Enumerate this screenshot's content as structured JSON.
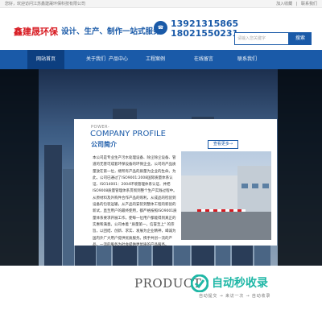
{
  "topbar": {
    "welcome": "您好，欢迎访问江苏鑫建晟环保科技有限公司",
    "links": [
      "加入收藏",
      "|",
      "联系我们"
    ]
  },
  "header": {
    "brand": "鑫建晟环保",
    "slogan": "设计、生产、制作一站式服务",
    "phone_icon": "phone-icon",
    "phone_1": "13921315865",
    "phone_2": "18021550231"
  },
  "search": {
    "placeholder": "请输入您关键字",
    "button": "搜索"
  },
  "nav": {
    "items": [
      {
        "label": "网站首页",
        "active": true
      },
      {
        "label": "关于我们",
        "active": false
      },
      {
        "label": "产品中心",
        "active": false
      },
      {
        "label": "工程案例",
        "active": false
      },
      {
        "label": "在线留言",
        "active": false
      },
      {
        "label": "联系我们",
        "active": false
      }
    ]
  },
  "profile": {
    "power": "POWER-",
    "title": "COMPANY PROFILE",
    "subtitle": "公司简介",
    "more": "查看更多→",
    "text": "本公司是专业生产污水处理设备、除尘除尘设备、管道的无害可成套环保设备的环保企业。公司的产品质量放在第一位，继所有产品的质量为企业的生命。为此，公司已通过了ISO9001:2008国际质量体系认证、ISO14001：2004环境管理体系认证、并把ISO9008质量管理体系贯彻到整个生产实践过程中。从原材料及外购件合作产品的购利，从成品的检验到设备的包装运输，从产品的安装到整体工程的新验的新试，直至用户的最终使用，都严格按照ISO9001质量体系要求开展工作，使每一位用户都能得到真正的实惠和满意。公司本着 \"质量第一，信誉至上\" 的宗旨，以团结、创新、求实、发展为企业精神，竭诚为国内外广大用户提供优质服务。携手共创一流的产品，一流的服务为社会提供更优质的产品服务。"
  },
  "product_title": "PRODUCT",
  "watermark": {
    "text": "自动秒收录",
    "sub": "自动提交 → 来访一次 → 自动收录"
  },
  "colors": {
    "primary": "#1a5aa8",
    "nav_active": "#0d3f80",
    "brand_red": "#d71920",
    "watermark": "#1fb7a6"
  }
}
